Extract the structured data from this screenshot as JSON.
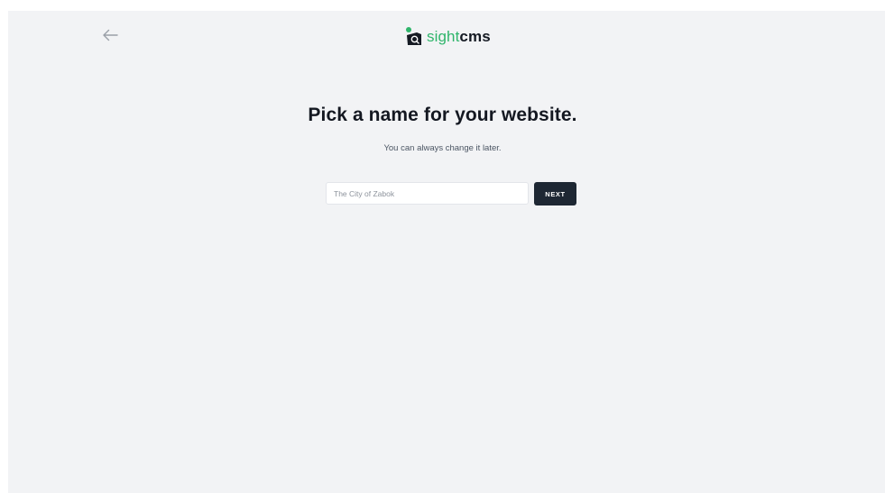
{
  "header": {
    "back_icon": "arrow-left-icon",
    "logo": {
      "icon": "sightcms-logo-icon",
      "text_sight": "sight",
      "text_cms": "cms",
      "color_sight": "#2fb56b",
      "color_cms": "#151a23"
    }
  },
  "main": {
    "title": "Pick a name for your website.",
    "subtitle": "You can always change it later.",
    "name_input": {
      "value": "",
      "placeholder": "The City of Zabok"
    },
    "next_label": "NEXT"
  },
  "colors": {
    "background": "#f2f3f5",
    "button": "#1e2733",
    "accent": "#2fb56b"
  }
}
